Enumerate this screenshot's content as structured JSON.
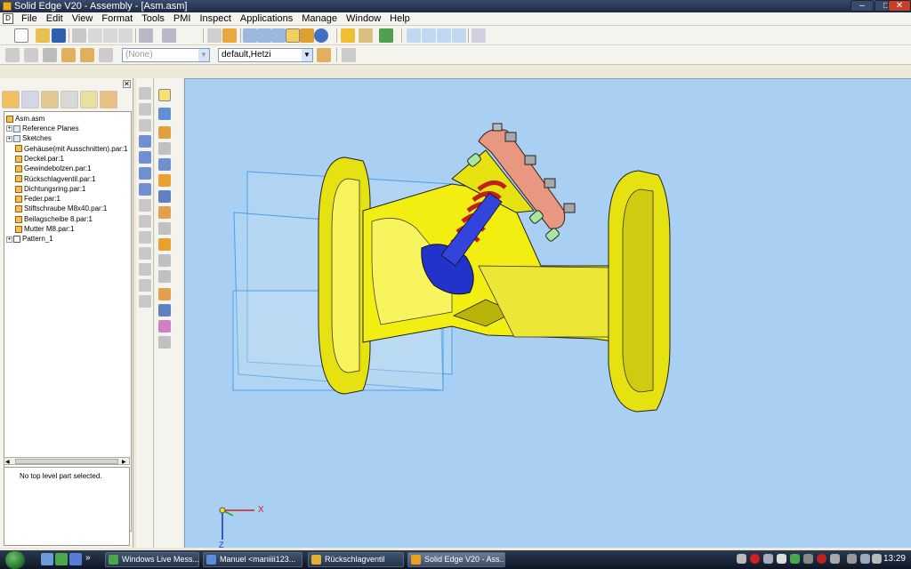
{
  "window": {
    "title": "Solid Edge V20 - Assembly - [Asm.asm]",
    "controls": [
      "–",
      "□",
      "✕"
    ]
  },
  "menu": [
    "File",
    "Edit",
    "View",
    "Format",
    "Tools",
    "PMI",
    "Inspect",
    "Applications",
    "Manage",
    "Window",
    "Help"
  ],
  "toolbar2": {
    "style_dropdown": "(None)",
    "view_dropdown": "default,Hetzi"
  },
  "tree": {
    "root": "Asm.asm",
    "items": [
      {
        "label": "Reference Planes",
        "kind": "planes",
        "expand": "+"
      },
      {
        "label": "Sketches",
        "kind": "sketch",
        "expand": "+"
      },
      {
        "label": "Gehäuse(mit Ausschnitten).par:1",
        "kind": "part",
        "expand": ""
      },
      {
        "label": "Deckel.par:1",
        "kind": "part",
        "expand": ""
      },
      {
        "label": "Gewindebolzen.par:1",
        "kind": "part",
        "expand": ""
      },
      {
        "label": "Rückschlagventil.par:1",
        "kind": "part",
        "expand": ""
      },
      {
        "label": "Dichtungsring.par:1",
        "kind": "part",
        "expand": ""
      },
      {
        "label": "Feder.par:1",
        "kind": "part",
        "expand": ""
      },
      {
        "label": "Stiftschraube M8x40.par:1",
        "kind": "part",
        "expand": ""
      },
      {
        "label": "Beilagscheibe 8.par:1",
        "kind": "part",
        "expand": ""
      },
      {
        "label": "Mutter M8.par:1",
        "kind": "part",
        "expand": ""
      },
      {
        "label": "Pattern_1",
        "kind": "pattern",
        "expand": "+"
      }
    ],
    "status_text": "No top level part selected."
  },
  "triad": {
    "x": "X",
    "z": "Z"
  },
  "taskbar": {
    "apps": [
      {
        "label": "Windows Live Mess...",
        "color": "#4aa84a",
        "active": false
      },
      {
        "label": "Manuel <maniiii123...",
        "color": "#5a8fd8",
        "active": false
      },
      {
        "label": "Rückschlagventil",
        "color": "#e0b030",
        "active": false
      },
      {
        "label": "Solid Edge V20 - Ass...",
        "color": "#e8a020",
        "active": true
      }
    ],
    "clock": "13:29",
    "overflow": "»"
  },
  "colors": {
    "viewport_bg": "#a9d0f2",
    "housing": "#f2ee12",
    "spring": "#c0201a",
    "valve": "#2233cc",
    "cover": "#e89880",
    "bolt": "#a8a8a8",
    "washer": "#a6e8a0"
  }
}
